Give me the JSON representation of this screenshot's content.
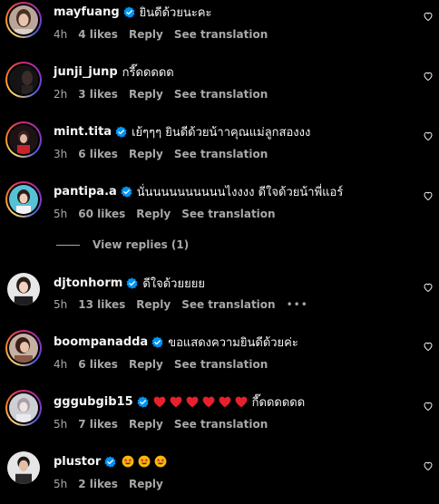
{
  "colors": {
    "background": "#000000",
    "primary_text": "#f5f5f5",
    "secondary_text": "#a8a8a8",
    "verified_blue": "#0095f6",
    "emoji_red": "#e8202b"
  },
  "comments": [
    {
      "username": "mayfuang",
      "verified": true,
      "text": "ยินดีด้วยนะคะ",
      "time": "4h",
      "likes": "4 likes",
      "reply": "Reply",
      "translate": "See translation",
      "avatar": "avatar-mayfuang",
      "story_ring": true
    },
    {
      "username": "junji_junp",
      "verified": false,
      "text": "กรี๊ดดดดด",
      "time": "2h",
      "likes": "3 likes",
      "reply": "Reply",
      "translate": "See translation",
      "avatar": "avatar-junji",
      "story_ring": true
    },
    {
      "username": "mint.tita",
      "verified": true,
      "text": "เย้ๆๆๆ ยินดีด้วยน้าาคุณแม่ลูกสองงง",
      "time": "3h",
      "likes": "6 likes",
      "reply": "Reply",
      "translate": "See translation",
      "avatar": "avatar-mint",
      "story_ring": true
    },
    {
      "username": "pantipa.a",
      "verified": true,
      "text": "นั่นนนนนนนนนนไงงงง ดีใจด้วยน้าพี่แอร์",
      "time": "5h",
      "likes": "60 likes",
      "reply": "Reply",
      "translate": "See translation",
      "avatar": "avatar-pantipa",
      "story_ring": true
    },
    {
      "username": "djtonhorm",
      "verified": true,
      "text": "ดีใจด้วยยยย",
      "time": "5h",
      "likes": "13 likes",
      "reply": "Reply",
      "translate": "See translation",
      "more": "•••",
      "avatar": "avatar-djtonhorm",
      "story_ring": false
    },
    {
      "username": "boompanadda",
      "verified": true,
      "text": "ขอแสดงความยินดีด้วยค่ะ",
      "time": "4h",
      "likes": "6 likes",
      "reply": "Reply",
      "translate": "See translation",
      "avatar": "avatar-boompanadda",
      "story_ring": true
    },
    {
      "username": "gggubgib15",
      "verified": true,
      "text": "กี๊ดดดดดด",
      "time": "5h",
      "likes": "7 likes",
      "reply": "Reply",
      "translate": "See translation",
      "avatar": "avatar-gggubgib",
      "story_ring": true
    },
    {
      "username": "plustor",
      "verified": true,
      "text": "",
      "time": "5h",
      "likes": "2 likes",
      "reply": "Reply",
      "avatar": "avatar-plustor",
      "story_ring": false
    }
  ],
  "view_replies": "View replies (1)",
  "icons": {
    "verified": "verified-badge-icon",
    "like": "heart-outline-icon",
    "red_heart": "red-heart-emoji",
    "star_struck": "star-struck-emoji"
  }
}
